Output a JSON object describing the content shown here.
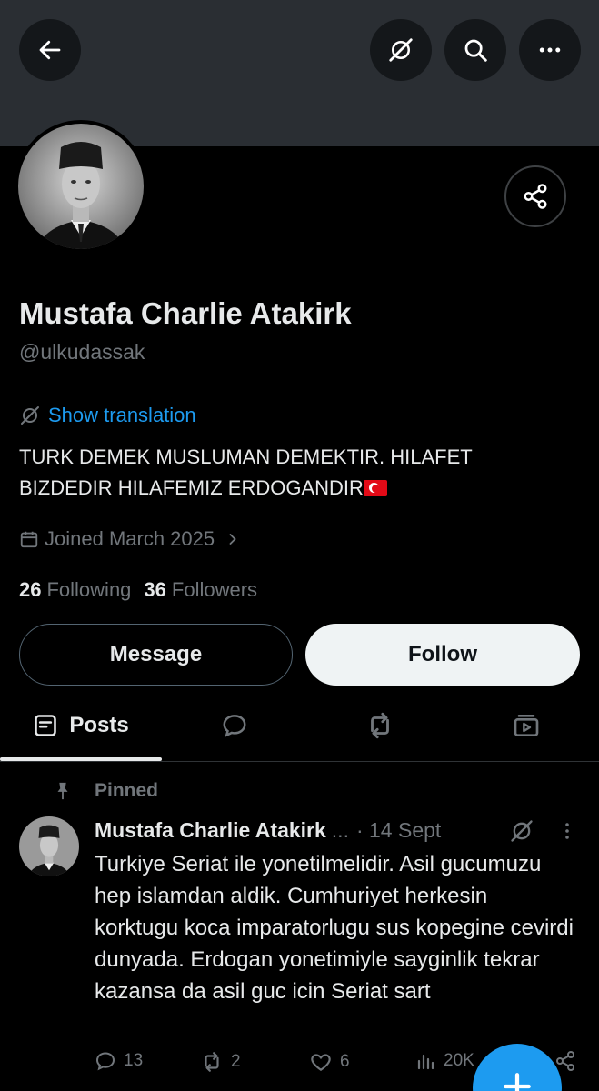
{
  "profile": {
    "name": "Mustafa Charlie Atakirk",
    "handle": "@ulkudassak",
    "translate_label": "Show translation",
    "bio": "TURK DEMEK MUSLUMAN DEMEKTIR. HILAFET BIZDEDIR HILAFEMIZ ERDOGANDIR",
    "joined": "Joined March 2025",
    "following_count": "26",
    "following_label": "Following",
    "followers_count": "36",
    "followers_label": "Followers"
  },
  "buttons": {
    "message": "Message",
    "follow": "Follow"
  },
  "tabs": {
    "posts": "Posts"
  },
  "post": {
    "pinned_label": "Pinned",
    "author": "Mustafa Charlie Atakirk",
    "ellipsis": "...",
    "date": "· 14 Sept",
    "text": "Turkiye Seriat ile yonetilmelidir. Asil gucumuzu hep islamdan aldik. Cumhuriyet herkesin korktugu koca imparatorlugu sus kopegine cevirdi dunyada. Erdogan yonetimiyle sayginlik tekrar kazansa da asil guc icin Seriat sart",
    "replies": "13",
    "reposts": "2",
    "likes": "6",
    "views": "20K"
  },
  "icons": [
    "back-arrow-icon",
    "grok-icon",
    "search-icon",
    "more-icon",
    "share-icon",
    "calendar-icon",
    "chevron-right-icon",
    "posts-icon",
    "replies-icon",
    "reposts-icon",
    "media-icon",
    "pin-icon",
    "reply-icon",
    "repost-icon",
    "like-icon",
    "views-icon",
    "plus-icon"
  ],
  "colors": {
    "accent": "#1d9bf0",
    "background": "#000000",
    "banner": "#2a2e33",
    "muted": "#71767b",
    "text": "#e7e9ea"
  }
}
